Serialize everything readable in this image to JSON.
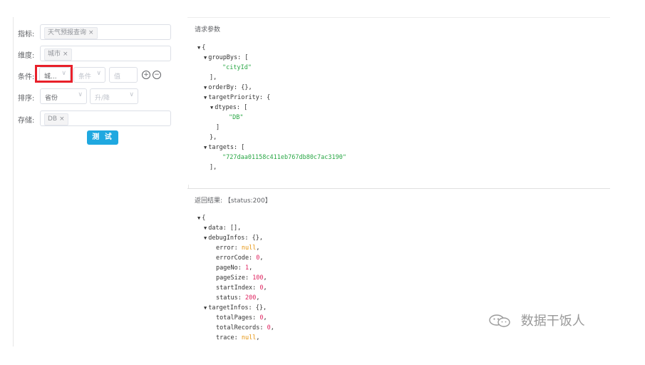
{
  "form": {
    "metric": {
      "label": "指标:",
      "tag": "天气预报查询"
    },
    "dimension": {
      "label": "维度:",
      "tag": "城市"
    },
    "condition": {
      "label": "条件:",
      "field": "城...",
      "operator_placeholder": "条件",
      "value_placeholder": "值"
    },
    "sort": {
      "label": "排序:",
      "field": "省份",
      "order_placeholder": "升/降"
    },
    "storage": {
      "label": "存储:",
      "tag": "DB"
    },
    "test_button": "测 试",
    "tag_close": "×",
    "add_symbol": "+",
    "remove_symbol": "−",
    "chevron": "∨"
  },
  "request_panel": {
    "title": "请求参数",
    "lines": [
      {
        "indent": 0,
        "tri": true,
        "parts": [
          {
            "t": "{",
            "c": "k"
          }
        ]
      },
      {
        "indent": 1,
        "tri": true,
        "parts": [
          {
            "t": "groupBys: [",
            "c": "k"
          }
        ]
      },
      {
        "indent": 3,
        "tri": false,
        "parts": [
          {
            "t": "\"cityId\"",
            "c": "s"
          }
        ]
      },
      {
        "indent": 1,
        "tri": false,
        "parts": [
          {
            "t": "],",
            "c": "k"
          }
        ]
      },
      {
        "indent": 1,
        "tri": true,
        "parts": [
          {
            "t": "orderBy: {},",
            "c": "k"
          }
        ]
      },
      {
        "indent": 1,
        "tri": true,
        "parts": [
          {
            "t": "targetPriority: {",
            "c": "k"
          }
        ]
      },
      {
        "indent": 2,
        "tri": true,
        "parts": [
          {
            "t": "dtypes: [",
            "c": "k"
          }
        ]
      },
      {
        "indent": 4,
        "tri": false,
        "parts": [
          {
            "t": "\"DB\"",
            "c": "s"
          }
        ]
      },
      {
        "indent": 2,
        "tri": false,
        "parts": [
          {
            "t": "]",
            "c": "k"
          }
        ]
      },
      {
        "indent": 1,
        "tri": false,
        "parts": [
          {
            "t": "},",
            "c": "k"
          }
        ]
      },
      {
        "indent": 1,
        "tri": true,
        "parts": [
          {
            "t": "targets: [",
            "c": "k"
          }
        ]
      },
      {
        "indent": 3,
        "tri": false,
        "parts": [
          {
            "t": "\"727daa01158c411eb767db80c7ac3190\"",
            "c": "s"
          }
        ]
      },
      {
        "indent": 1,
        "tri": false,
        "parts": [
          {
            "t": "],",
            "c": "k"
          }
        ]
      }
    ]
  },
  "response_panel": {
    "title": "返回结果: 【status:200】",
    "lines": [
      {
        "indent": 0,
        "tri": true,
        "parts": [
          {
            "t": "{",
            "c": "k"
          }
        ]
      },
      {
        "indent": 1,
        "tri": true,
        "parts": [
          {
            "t": "data: [],",
            "c": "k"
          }
        ]
      },
      {
        "indent": 1,
        "tri": true,
        "parts": [
          {
            "t": "debugInfos: {},",
            "c": "k"
          }
        ]
      },
      {
        "indent": 2,
        "tri": false,
        "parts": [
          {
            "t": "error: ",
            "c": "k"
          },
          {
            "t": "null",
            "c": "nl"
          },
          {
            "t": ",",
            "c": "k"
          }
        ]
      },
      {
        "indent": 2,
        "tri": false,
        "parts": [
          {
            "t": "errorCode: ",
            "c": "k"
          },
          {
            "t": "0",
            "c": "n"
          },
          {
            "t": ",",
            "c": "k"
          }
        ]
      },
      {
        "indent": 2,
        "tri": false,
        "parts": [
          {
            "t": "pageNo: ",
            "c": "k"
          },
          {
            "t": "1",
            "c": "n"
          },
          {
            "t": ",",
            "c": "k"
          }
        ]
      },
      {
        "indent": 2,
        "tri": false,
        "parts": [
          {
            "t": "pageSize: ",
            "c": "k"
          },
          {
            "t": "100",
            "c": "n"
          },
          {
            "t": ",",
            "c": "k"
          }
        ]
      },
      {
        "indent": 2,
        "tri": false,
        "parts": [
          {
            "t": "startIndex: ",
            "c": "k"
          },
          {
            "t": "0",
            "c": "n"
          },
          {
            "t": ",",
            "c": "k"
          }
        ]
      },
      {
        "indent": 2,
        "tri": false,
        "parts": [
          {
            "t": "status: ",
            "c": "k"
          },
          {
            "t": "200",
            "c": "n"
          },
          {
            "t": ",",
            "c": "k"
          }
        ]
      },
      {
        "indent": 1,
        "tri": true,
        "parts": [
          {
            "t": "targetInfos: {},",
            "c": "k"
          }
        ]
      },
      {
        "indent": 2,
        "tri": false,
        "parts": [
          {
            "t": "totalPages: ",
            "c": "k"
          },
          {
            "t": "0",
            "c": "n"
          },
          {
            "t": ",",
            "c": "k"
          }
        ]
      },
      {
        "indent": 2,
        "tri": false,
        "parts": [
          {
            "t": "totalRecords: ",
            "c": "k"
          },
          {
            "t": "0",
            "c": "n"
          },
          {
            "t": ",",
            "c": "k"
          }
        ]
      },
      {
        "indent": 2,
        "tri": false,
        "parts": [
          {
            "t": "trace: ",
            "c": "k"
          },
          {
            "t": "null",
            "c": "nl"
          },
          {
            "t": ",",
            "c": "k"
          }
        ]
      }
    ]
  },
  "watermark": "数据干饭人"
}
